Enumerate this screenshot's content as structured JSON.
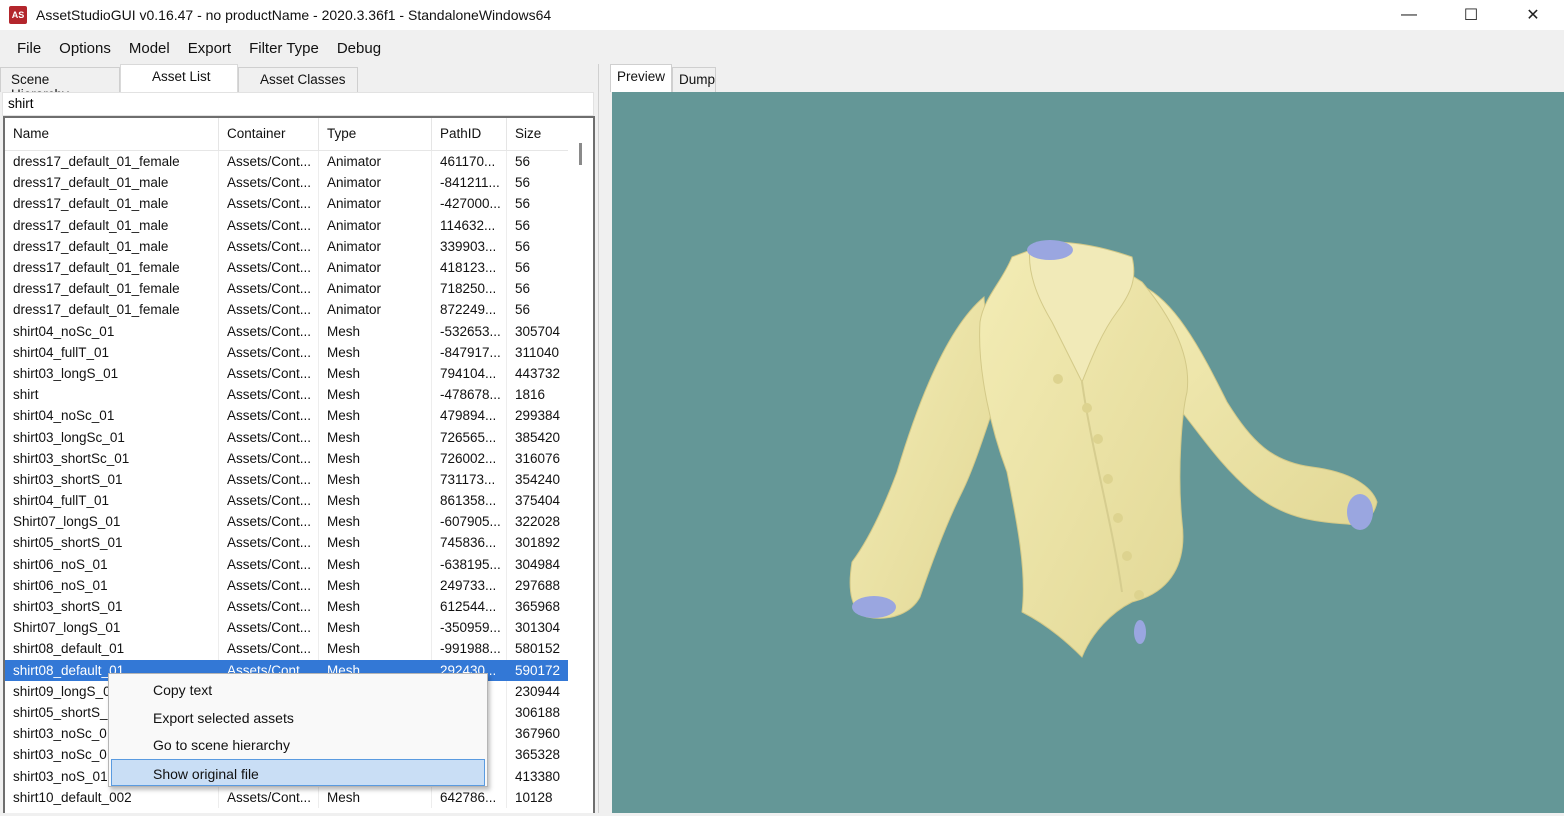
{
  "window": {
    "icon_text": "AS",
    "title": "AssetStudioGUI v0.16.47 - no productName - 2020.3.36f1 - StandaloneWindows64",
    "controls": {
      "minimize": "—",
      "maximize": "☐",
      "close": "✕"
    }
  },
  "menu": [
    "File",
    "Options",
    "Model",
    "Export",
    "Filter Type",
    "Debug"
  ],
  "left_tabs": [
    "Scene Hierarchy",
    "Asset List",
    "Asset Classes"
  ],
  "active_left_tab": "Asset List",
  "search": {
    "value": "shirt"
  },
  "columns": [
    "Name",
    "Container",
    "Type",
    "PathID",
    "Size"
  ],
  "rows": [
    [
      "dress17_default_01_female",
      "Assets/Cont...",
      "Animator",
      "461170...",
      "56"
    ],
    [
      "dress17_default_01_male",
      "Assets/Cont...",
      "Animator",
      "-841211...",
      "56"
    ],
    [
      "dress17_default_01_male",
      "Assets/Cont...",
      "Animator",
      "-427000...",
      "56"
    ],
    [
      "dress17_default_01_male",
      "Assets/Cont...",
      "Animator",
      "114632...",
      "56"
    ],
    [
      "dress17_default_01_male",
      "Assets/Cont...",
      "Animator",
      "339903...",
      "56"
    ],
    [
      "dress17_default_01_female",
      "Assets/Cont...",
      "Animator",
      "418123...",
      "56"
    ],
    [
      "dress17_default_01_female",
      "Assets/Cont...",
      "Animator",
      "718250...",
      "56"
    ],
    [
      "dress17_default_01_female",
      "Assets/Cont...",
      "Animator",
      "872249...",
      "56"
    ],
    [
      "shirt04_noSc_01",
      "Assets/Cont...",
      "Mesh",
      "-532653...",
      "305704"
    ],
    [
      "shirt04_fullT_01",
      "Assets/Cont...",
      "Mesh",
      "-847917...",
      "311040"
    ],
    [
      "shirt03_longS_01",
      "Assets/Cont...",
      "Mesh",
      "794104...",
      "443732"
    ],
    [
      "shirt",
      "Assets/Cont...",
      "Mesh",
      "-478678...",
      "1816"
    ],
    [
      "shirt04_noSc_01",
      "Assets/Cont...",
      "Mesh",
      "479894...",
      "299384"
    ],
    [
      "shirt03_longSc_01",
      "Assets/Cont...",
      "Mesh",
      "726565...",
      "385420"
    ],
    [
      "shirt03_shortSc_01",
      "Assets/Cont...",
      "Mesh",
      "726002...",
      "316076"
    ],
    [
      "shirt03_shortS_01",
      "Assets/Cont...",
      "Mesh",
      "731173...",
      "354240"
    ],
    [
      "shirt04_fullT_01",
      "Assets/Cont...",
      "Mesh",
      "861358...",
      "375404"
    ],
    [
      "Shirt07_longS_01",
      "Assets/Cont...",
      "Mesh",
      "-607905...",
      "322028"
    ],
    [
      "shirt05_shortS_01",
      "Assets/Cont...",
      "Mesh",
      "745836...",
      "301892"
    ],
    [
      "shirt06_noS_01",
      "Assets/Cont...",
      "Mesh",
      "-638195...",
      "304984"
    ],
    [
      "shirt06_noS_01",
      "Assets/Cont...",
      "Mesh",
      "249733...",
      "297688"
    ],
    [
      "shirt03_shortS_01",
      "Assets/Cont...",
      "Mesh",
      "612544...",
      "365968"
    ],
    [
      "Shirt07_longS_01",
      "Assets/Cont...",
      "Mesh",
      "-350959...",
      "301304"
    ],
    [
      "shirt08_default_01",
      "Assets/Cont...",
      "Mesh",
      "-991988...",
      "580152"
    ],
    [
      "shirt08_default_01",
      "Assets/Cont...",
      "Mesh",
      "292430...",
      "590172"
    ],
    [
      "shirt09_longS_0",
      "",
      "",
      "",
      "230944"
    ],
    [
      "shirt05_shortS_(",
      "",
      "",
      "",
      "306188"
    ],
    [
      "shirt03_noSc_0",
      "",
      "",
      "",
      "367960"
    ],
    [
      "shirt03_noSc_0",
      "",
      "",
      "",
      "365328"
    ],
    [
      "shirt03_noS_01",
      "",
      "",
      "",
      "413380"
    ],
    [
      "shirt10_default_002",
      "Assets/Cont...",
      "Mesh",
      "642786...",
      "10128"
    ]
  ],
  "selected_row": 24,
  "context_menu": [
    "Copy text",
    "Export selected assets",
    "Go to scene hierarchy",
    "Show original file"
  ],
  "context_menu_highlight": 3,
  "right_tabs": [
    "Preview",
    "Dump"
  ],
  "active_right_tab": "Preview",
  "colors": {
    "preview_bg": "#649797",
    "shirt": "#eee6aa",
    "shirt_shadow": "#cfc585",
    "inner": "#9aa6e0",
    "selection": "#3378d6"
  }
}
